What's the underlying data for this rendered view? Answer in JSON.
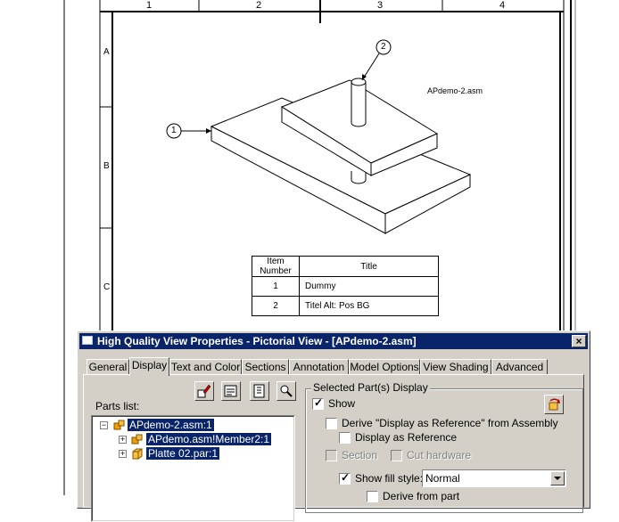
{
  "drawing": {
    "columns": [
      "1",
      "2",
      "3",
      "4"
    ],
    "rows": [
      "A",
      "B",
      "C"
    ],
    "assembly_label": "APdemo-2.asm",
    "balloons": [
      "1",
      "2"
    ],
    "parts_table": {
      "headers": [
        "Item Number",
        "Title"
      ],
      "rows": [
        [
          "1",
          "Dummy"
        ],
        [
          "2",
          "Titel Alt: Pos BG"
        ]
      ]
    }
  },
  "dialog": {
    "title": "High Quality View Properties - Pictorial View - [APdemo-2.asm]",
    "close_label": "×",
    "tabs": [
      "General",
      "Display",
      "Text and Color",
      "Sections",
      "Annotation",
      "Model Options",
      "View Shading",
      "Advanced"
    ],
    "active_tab": "Display",
    "parts_list_label": "Parts list:",
    "toolbar_icons": [
      "select-parts-icon",
      "show-hide-icon",
      "tree-view-icon",
      "find-icon"
    ],
    "tree": [
      {
        "label": "APdemo-2.asm:1",
        "expander": "−",
        "icon": "assembly-icon"
      },
      {
        "label": "APdemo.asm!Member2:1",
        "expander": "+",
        "icon": "assembly-icon"
      },
      {
        "label": "Platte 02.par:1",
        "expander": "+",
        "icon": "part-icon"
      }
    ],
    "selected_group": {
      "title": "Selected Part(s) Display",
      "show_label": "Show",
      "show_checked": true,
      "derive_label": "Derive \"Display as Reference\" from Assembly",
      "derive_checked": false,
      "display_ref_label": "Display as Reference",
      "display_ref_checked": false,
      "section_label": "Section",
      "cut_hardware_label": "Cut hardware",
      "show_fill_label": "Show fill style:",
      "show_fill_checked": true,
      "fill_style_value": "Normal",
      "derive_from_part_label": "Derive from part"
    }
  },
  "colors": {
    "selection": "#0a246a",
    "dialog_face": "#d4d0c8"
  }
}
